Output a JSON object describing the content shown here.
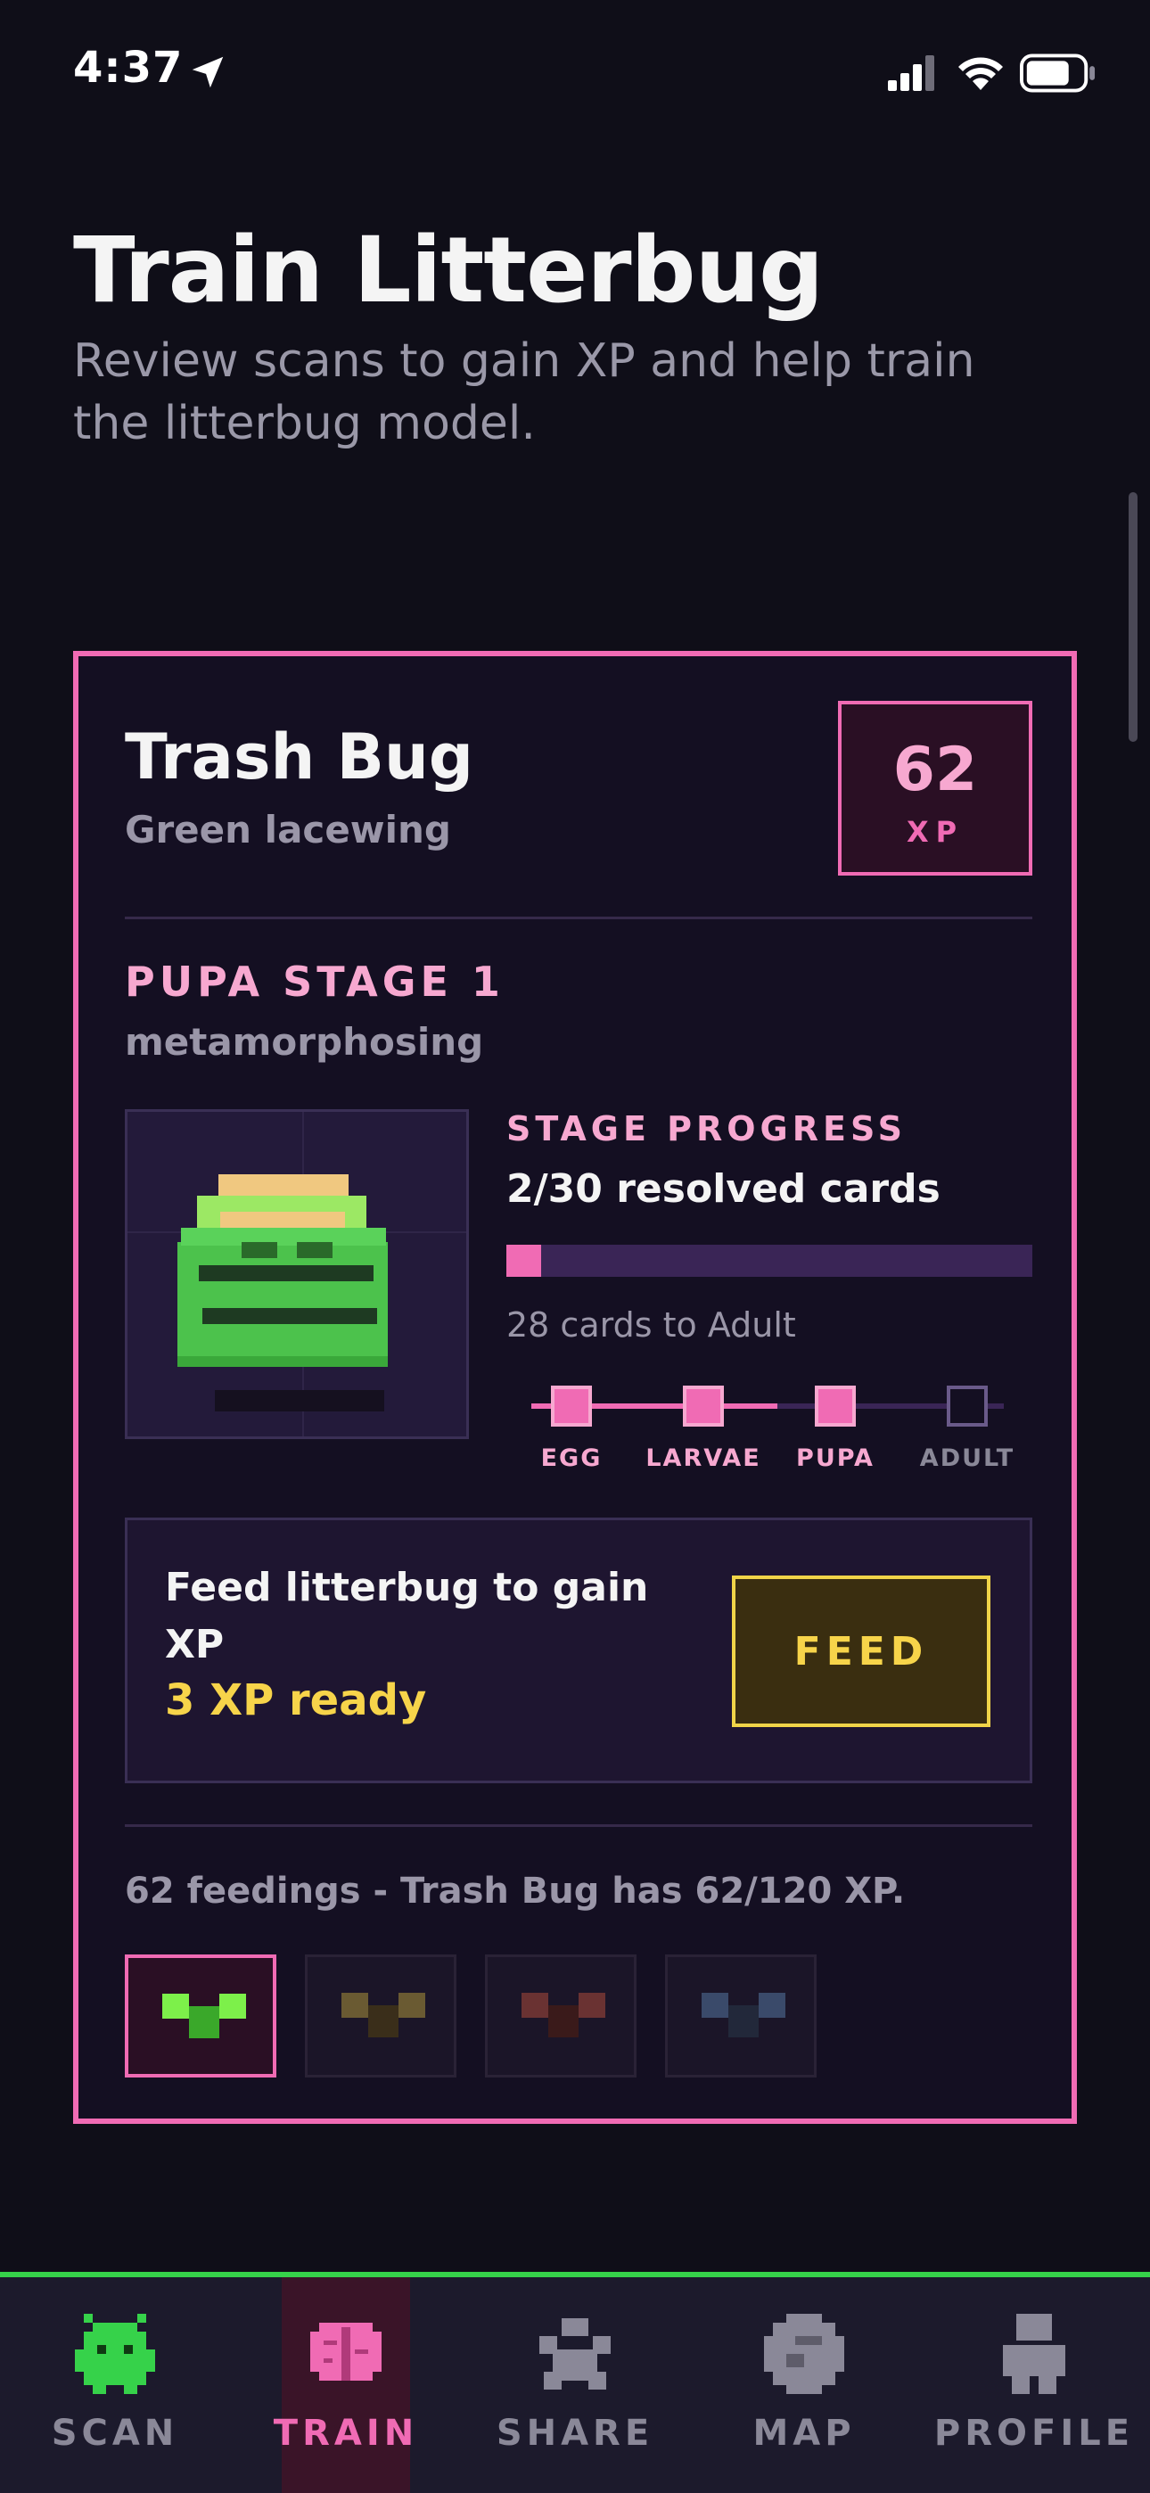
{
  "status_bar": {
    "time": "4:37"
  },
  "header": {
    "title": "Train Litterbug",
    "subtitle": "Review scans to gain XP and help train the litterbug model."
  },
  "bug": {
    "name": "Trash Bug",
    "species": "Green lacewing",
    "xp_value": "62",
    "xp_label": "XP"
  },
  "stage": {
    "title": "PUPA STAGE 1",
    "subtitle": "metamorphosing",
    "progress_label": "STAGE PROGRESS",
    "progress_count": "2/30 resolved cards",
    "progress_fraction": 0.0667,
    "cards_to": "28 cards to Adult",
    "stages": [
      {
        "name": "EGG",
        "done": true
      },
      {
        "name": "LARVAE",
        "done": true
      },
      {
        "name": "PUPA",
        "done": true
      },
      {
        "name": "ADULT",
        "done": false
      }
    ]
  },
  "feed": {
    "text": "Feed litterbug to gain XP",
    "ready": "3 XP ready",
    "button_label": "FEED"
  },
  "feedings_text": "62 feedings - Trash Bug has 62/120 XP.",
  "variants": [
    {
      "color": "#7df04a",
      "dark": "#3aa82a",
      "selected": true
    },
    {
      "color": "#6a5a32",
      "dark": "#3a2e1a",
      "selected": false
    },
    {
      "color": "#6a3232",
      "dark": "#3a1a1a",
      "selected": false
    },
    {
      "color": "#3a4a6a",
      "dark": "#22283a",
      "selected": false
    }
  ],
  "tabs": [
    {
      "label": "SCAN",
      "icon": "alien-bug-icon",
      "color": "#8a8898",
      "active": false
    },
    {
      "label": "TRAIN",
      "icon": "brain-icon",
      "color": "#f06bb4",
      "active": true
    },
    {
      "label": "SHARE",
      "icon": "paw-icon",
      "color": "#8a8898",
      "active": false
    },
    {
      "label": "MAP",
      "icon": "globe-icon",
      "color": "#8a8898",
      "active": false
    },
    {
      "label": "PROFILE",
      "icon": "person-icon",
      "color": "#8a8898",
      "active": false
    }
  ],
  "colors": {
    "accent_pink": "#f06bb4",
    "accent_yellow": "#f7d44a",
    "accent_green": "#36d24a",
    "background": "#0f0e18"
  }
}
